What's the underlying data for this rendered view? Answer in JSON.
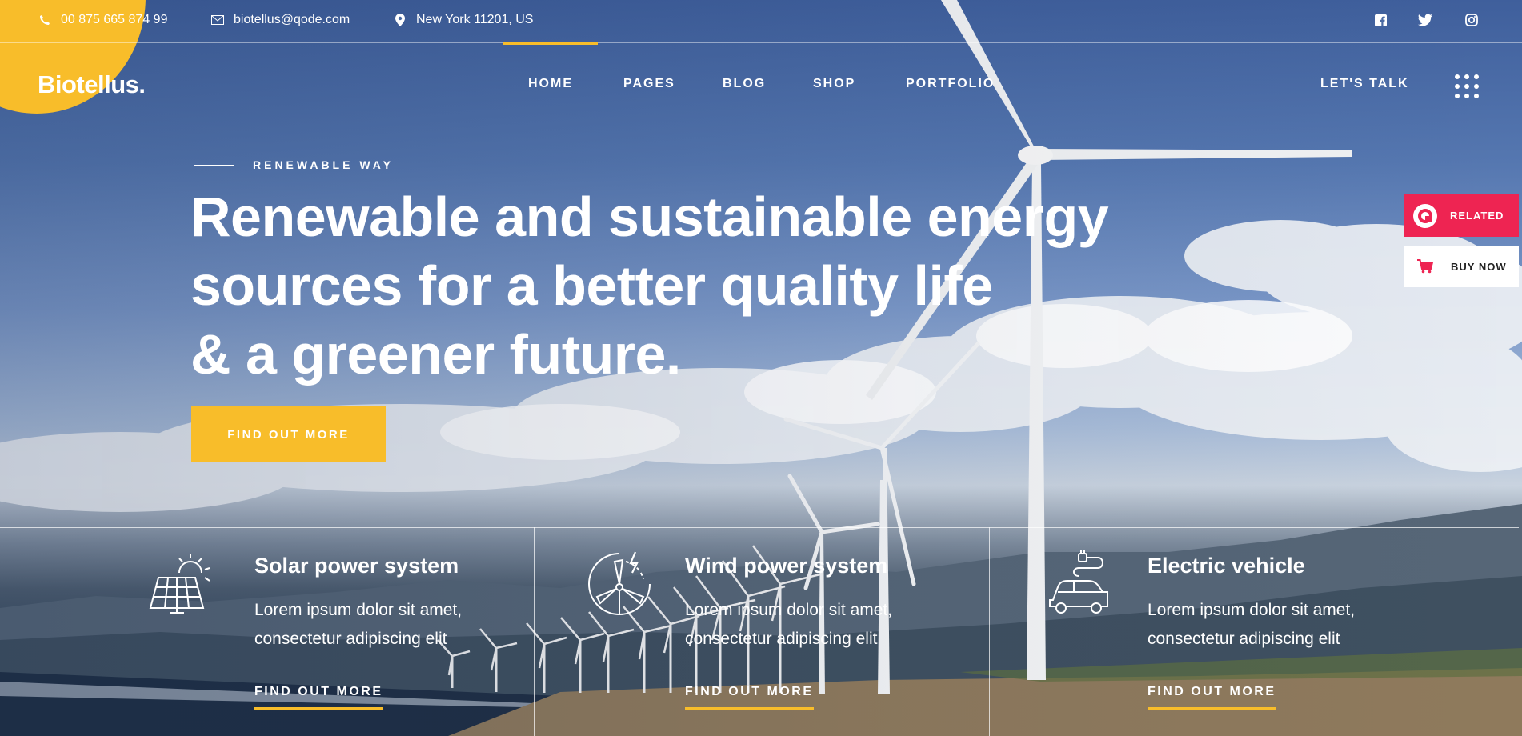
{
  "topbar": {
    "phone": "00 875 665 874 99",
    "email": "biotellus@qode.com",
    "location": "New York 11201, US",
    "icons": {
      "phone": "phone-icon",
      "email": "envelope-icon",
      "location": "map-pin-icon"
    },
    "social": [
      "facebook-icon",
      "twitter-icon",
      "instagram-icon"
    ]
  },
  "header": {
    "logo": "Biotellus.",
    "nav": [
      "HOME",
      "PAGES",
      "BLOG",
      "SHOP",
      "PORTFOLIO"
    ],
    "active_nav": "HOME",
    "cta_label": "LET'S TALK",
    "menu_icon": "grid-dots-icon"
  },
  "hero": {
    "eyebrow": "RENEWABLE WAY",
    "headline": [
      "Renewable and sustainable energy",
      "sources for a better quality life",
      "& a greener future."
    ],
    "button": "FIND OUT MORE"
  },
  "side_buttons": {
    "related": "RELATED",
    "buy_now": "BUY NOW"
  },
  "features": [
    {
      "icon": "solar-panel-icon",
      "title": "Solar power system",
      "desc_lines": [
        "Lorem ipsum dolor sit amet,",
        "consectetur adipiscing elit"
      ],
      "link": "FIND OUT MORE"
    },
    {
      "icon": "wind-turbine-icon",
      "title": "Wind power system",
      "desc_lines": [
        "Lorem ipsum dolor sit amet,",
        "consectetur adipiscing elit"
      ],
      "link": "FIND OUT MORE"
    },
    {
      "icon": "electric-car-icon",
      "title": "Electric vehicle",
      "desc_lines": [
        "Lorem ipsum dolor sit amet,",
        "consectetur adipiscing elit"
      ],
      "link": "FIND OUT MORE"
    }
  ],
  "colors": {
    "accent": "#f8bd2a",
    "related_bg": "#ee2452",
    "text": "#ffffff"
  }
}
